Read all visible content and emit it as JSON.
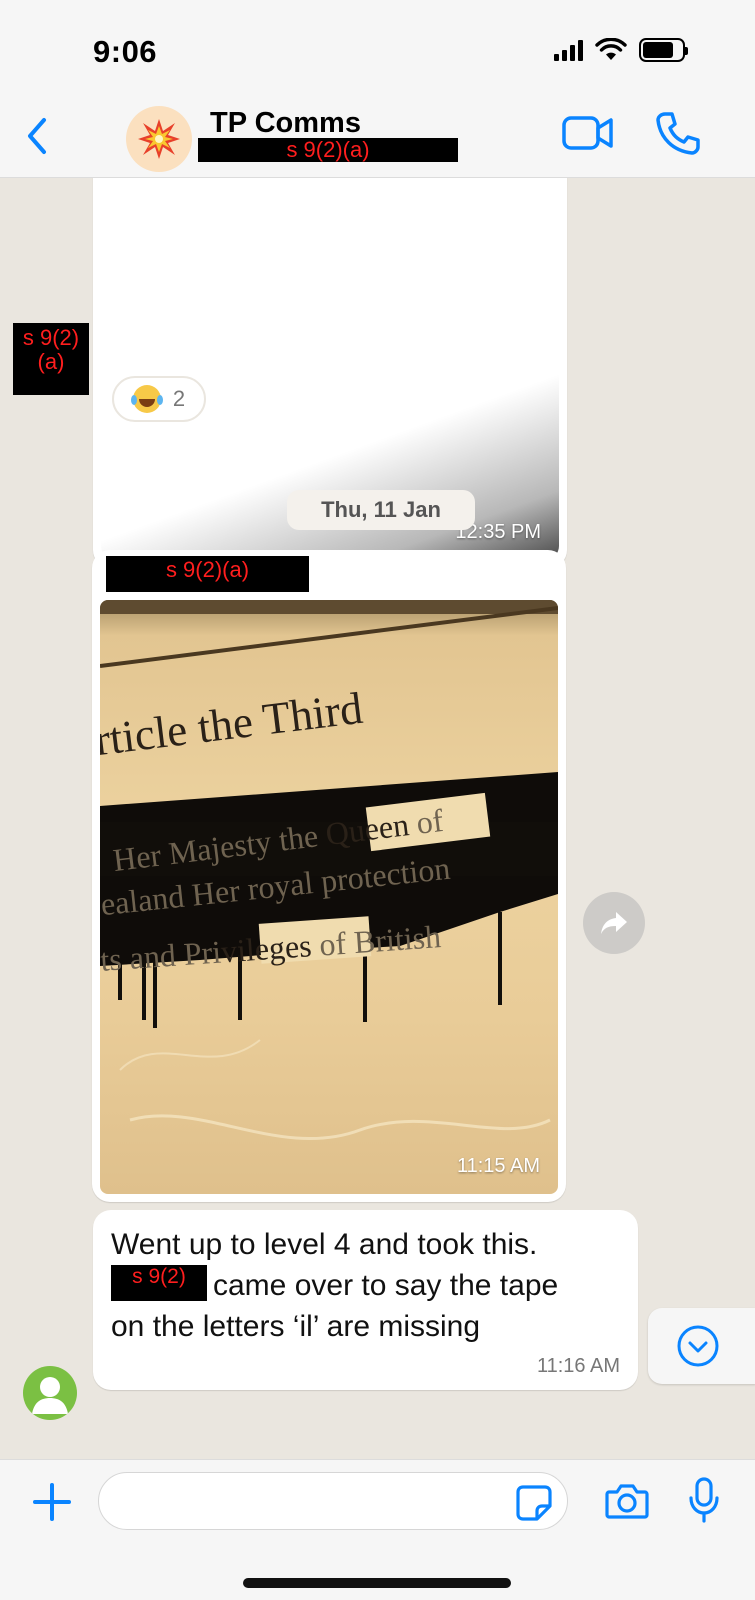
{
  "status_bar": {
    "time": "9:06"
  },
  "header": {
    "contact_name": "TP Comms",
    "redaction_label": "s 9(2)(a)"
  },
  "messages": [
    {
      "type": "image",
      "time": "12:35 PM",
      "reaction": {
        "emoji": "face-with-tears-of-joy",
        "count": "2"
      },
      "side_redaction": [
        "s 9(2)",
        "(a)"
      ]
    },
    {
      "type": "date",
      "label": "Thu, 11 Jan"
    },
    {
      "type": "image",
      "sender_redaction": "s 9(2)(a)",
      "photo_text": {
        "line1": "rticle the Third",
        "line2_left": "Her Majesty",
        "line2_frag": "the",
        "line2_tape": "Queen",
        "line2_right": "of",
        "line3_left": "ealand Her",
        "line3_mid": "royal protection",
        "line4_left": "ts and",
        "line4_frag": "Pri",
        "line4_tape": "vileges",
        "line4_right": "of British"
      },
      "time": "11:15 AM"
    },
    {
      "type": "text",
      "line1": "Went up to level 4 and took this.",
      "redaction": "s 9(2)",
      "line2": "came over to say the tape",
      "line3": "on the letters ‘il’ are missing",
      "time": "11:16 AM"
    }
  ],
  "input": {
    "placeholder": ""
  },
  "colors": {
    "accent": "#0a84ff",
    "chat_bg": "#eae6df",
    "redaction_text": "#ff1e1e"
  },
  "icons": {
    "back": "chevron-left-icon",
    "video": "video-camera-icon",
    "call": "phone-icon",
    "plus": "plus-icon",
    "sticker": "sticker-icon",
    "camera": "camera-icon",
    "mic": "microphone-icon",
    "scroll": "chevron-down-circle-icon",
    "forward": "forward-arrow-icon"
  }
}
